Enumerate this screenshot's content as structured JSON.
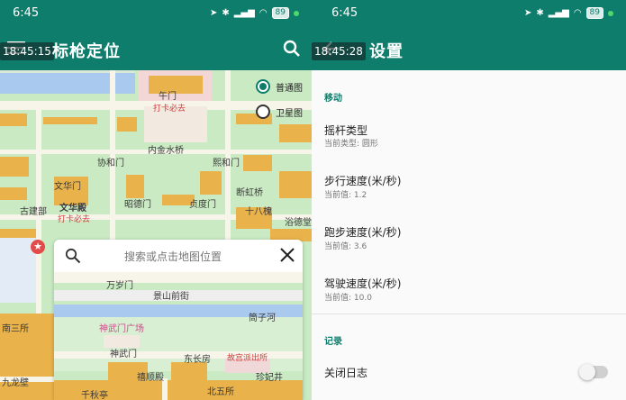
{
  "left": {
    "status": {
      "time": "6:45",
      "battery": "89"
    },
    "app_bar": {
      "title": "标枪定位",
      "overlay_time": "18:45:15"
    },
    "map": {
      "labels": {
        "wumen": "午门",
        "daka1": "打卡必去",
        "neijinshuiqiao": "内金水桥",
        "xiehemen": "协和门",
        "xihemen": "熙和门",
        "wenhuamen": "文华门",
        "zhaodemen": "昭德门",
        "zhendumen": "贞度门",
        "duanhongqiao": "断虹桥",
        "gujianzhu": "古建部",
        "wenhuadian": "文华殿",
        "daka2": "打卡必去",
        "shibakuai": "十八槐",
        "yuchi": "浴德堂"
      },
      "layers": [
        {
          "label": "普通图",
          "checked": true
        },
        {
          "label": "卫星图",
          "checked": false
        }
      ]
    },
    "search": {
      "placeholder": "搜索或点击地图位置",
      "mini_map_labels": {
        "wansuimen": "万岁门",
        "jingshanqianjie": "景山前街",
        "tongzihe": "筒子河",
        "shenwumenguangchang": "神武门广场",
        "shenwumen": "神武门",
        "dongchangfang": "东长房",
        "gugongpaichusuo": "故宫派出所",
        "zhenfeijing": "珍妃井",
        "qiongyuandian": "禧顺殿",
        "beiwusuo": "北五所",
        "nansansuo": "南三所",
        "jiulongbi": "九龙壁",
        "qianqiuting": "千秋亭"
      }
    }
  },
  "right": {
    "status": {
      "time": "6:45",
      "battery": "89"
    },
    "app_bar": {
      "title": "设置",
      "overlay_time": "18:45:28"
    },
    "sections": [
      {
        "header": "移动",
        "items": [
          {
            "title": "摇杆类型",
            "subtitle": "当前类型: 圆形"
          },
          {
            "title": "步行速度(米/秒)",
            "subtitle": "当前值: 1.2"
          },
          {
            "title": "跑步速度(米/秒)",
            "subtitle": "当前值: 3.6"
          },
          {
            "title": "驾驶速度(米/秒)",
            "subtitle": "当前值: 10.0"
          }
        ]
      },
      {
        "header": "记录",
        "items": [
          {
            "title": "关闭日志",
            "toggle": false
          }
        ]
      }
    ]
  },
  "colors": {
    "primary": "#0f7d6c",
    "map_green": "#c9eac3",
    "water": "#a9c9ef",
    "road": "#f7f4e9",
    "palace": "#e9b24b"
  }
}
